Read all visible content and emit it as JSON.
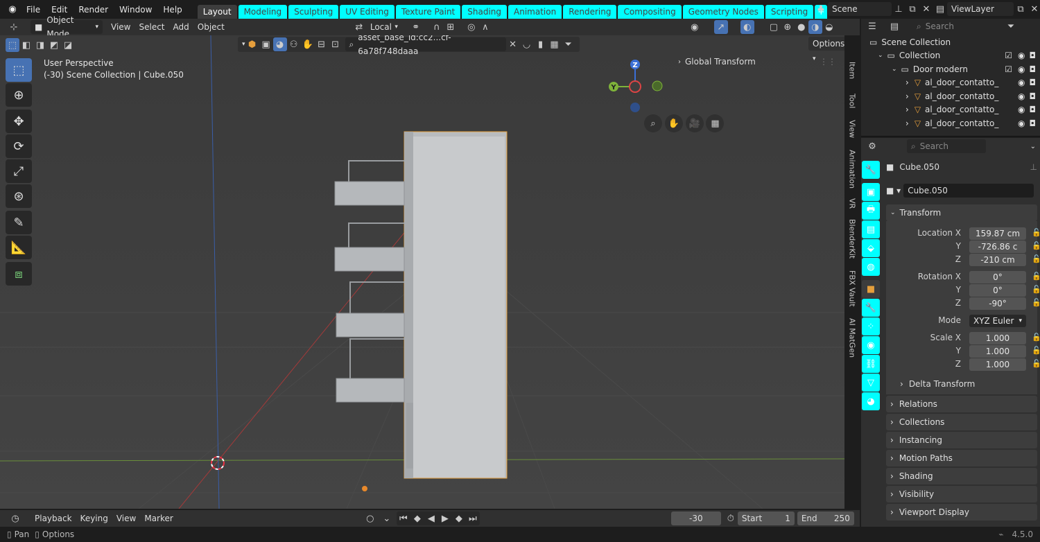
{
  "menu": [
    "File",
    "Edit",
    "Render",
    "Window",
    "Help"
  ],
  "workspaces": [
    "Layout",
    "Modeling",
    "Sculpting",
    "UV Editing",
    "Texture Paint",
    "Shading",
    "Animation",
    "Rendering",
    "Compositing",
    "Geometry Nodes",
    "Scripting"
  ],
  "scene": "Scene",
  "view_layer": "ViewLayer",
  "vp_header": {
    "mode": "Object Mode",
    "menus": [
      "View",
      "Select",
      "Add",
      "Object"
    ],
    "orientation": "Local",
    "asset_search": "asset_base_id:cc2...cf-6a78f748daaa",
    "options": "Options"
  },
  "overlay": {
    "perspective": "User Perspective",
    "context": "(-30) Scene Collection | Cube.050",
    "global_transform": "Global Transform"
  },
  "gizmo": {
    "z": "Z",
    "y": "Y"
  },
  "ntabs": [
    "Item",
    "Tool",
    "View",
    "Animation",
    "VR",
    "BlenderKit",
    "FBX Vault",
    "AI MatGen"
  ],
  "outliner": {
    "search_placeholder": "Search",
    "rows": [
      {
        "label": "Scene Collection",
        "indent": 0
      },
      {
        "label": "Collection",
        "indent": 1
      },
      {
        "label": "Door modern",
        "indent": 2
      },
      {
        "label": "al_door_contatto_",
        "indent": 3
      },
      {
        "label": "al_door_contatto_",
        "indent": 3
      },
      {
        "label": "al_door_contatto_",
        "indent": 3
      },
      {
        "label": "al_door_contatto_",
        "indent": 3
      }
    ]
  },
  "props": {
    "search_placeholder": "Search",
    "object": "Cube.050",
    "object_name": "Cube.050",
    "transform": "Transform",
    "location": {
      "label": "Location X",
      "x": "159.87 cm",
      "y": "-726.86 c",
      "z": "-210 cm"
    },
    "rotation": {
      "label": "Rotation X",
      "x": "0°",
      "y": "0°",
      "z": "-90°"
    },
    "mode_label": "Mode",
    "mode": "XYZ Euler",
    "scale": {
      "label": "Scale X",
      "x": "1.000",
      "y": "1.000",
      "z": "1.000"
    },
    "axis_y": "Y",
    "axis_z": "Z",
    "delta": "Delta Transform",
    "sections": [
      "Relations",
      "Collections",
      "Instancing",
      "Motion Paths",
      "Shading",
      "Visibility",
      "Viewport Display"
    ]
  },
  "timeline": {
    "menus": [
      "Playback",
      "Keying",
      "View",
      "Marker"
    ],
    "current": "-30",
    "start_label": "Start",
    "start": "1",
    "end_label": "End",
    "end": "250"
  },
  "status": {
    "pan": "Pan",
    "options": "Options",
    "version": "4.5.0"
  }
}
